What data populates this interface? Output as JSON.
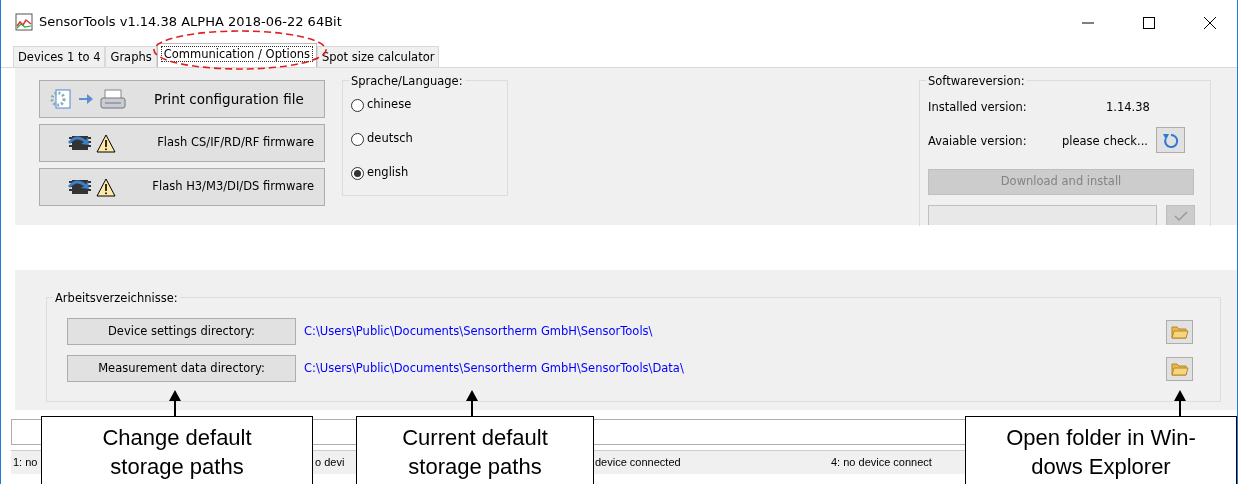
{
  "window": {
    "title": "SensorTools v1.14.38 ALPHA 2018-06-22 64Bit"
  },
  "tabs": [
    {
      "label": "Devices 1 to 4",
      "selected": false
    },
    {
      "label": "Graphs",
      "selected": false
    },
    {
      "label": "Communication / Options",
      "selected": true
    },
    {
      "label": "Spot size calculator",
      "selected": false
    }
  ],
  "actions": [
    {
      "kind": "print",
      "label": "Print configuration file"
    },
    {
      "kind": "flash",
      "label": "Flash CS/IF/RD/RF firmware"
    },
    {
      "kind": "flash",
      "label": "Flash H3/M3/DI/DS firmware"
    }
  ],
  "language": {
    "label": "Sprache/Language:",
    "options": [
      {
        "label": "chinese",
        "selected": false
      },
      {
        "label": "deutsch",
        "selected": false
      },
      {
        "label": "english",
        "selected": true
      }
    ]
  },
  "software": {
    "label": "Softwareversion:",
    "installed_label": "Installed version:",
    "installed_value": "1.14.38",
    "available_label": "Avaiable version:",
    "available_value": "please check...",
    "download_button": {
      "label": "Download and install",
      "disabled": true
    }
  },
  "directories": {
    "label": "Arbeitsverzeichnisse:",
    "rows": [
      {
        "button": "Device settings directory:",
        "path": "C:\\Users\\Public\\Documents\\Sensortherm GmbH\\SensorTools\\"
      },
      {
        "button": "Measurement data directory:",
        "path": "C:\\Users\\Public\\Documents\\Sensortherm GmbH\\SensorTools\\Data\\"
      }
    ]
  },
  "status_bar": [
    "1: no",
    "o devi",
    "device connected",
    "4: no device connect"
  ],
  "annotations": [
    {
      "text": "Change default\nstorage paths"
    },
    {
      "text": "Current default\nstorage paths"
    },
    {
      "text": "Open folder in Win-\ndows Explorer"
    }
  ]
}
